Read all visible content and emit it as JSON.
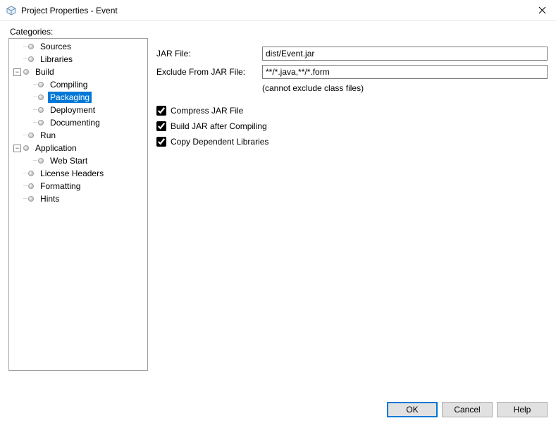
{
  "window": {
    "title": "Project Properties - Event",
    "close_glyph": "✕"
  },
  "categories_label": "Categories:",
  "tree": {
    "sources": "Sources",
    "libraries": "Libraries",
    "build": "Build",
    "build_compiling": "Compiling",
    "build_packaging": "Packaging",
    "build_deployment": "Deployment",
    "build_documenting": "Documenting",
    "run": "Run",
    "application": "Application",
    "application_webstart": "Web Start",
    "license_headers": "License Headers",
    "formatting": "Formatting",
    "hints": "Hints",
    "expander_minus": "−"
  },
  "form": {
    "jar_file_label": "JAR File:",
    "jar_file_value": "dist/Event.jar",
    "exclude_label": "Exclude From JAR File:",
    "exclude_value": "**/*.java,**/*.form",
    "exclude_hint": "(cannot exclude class files)",
    "compress_label": "Compress JAR File",
    "build_after_label": "Build JAR after Compiling",
    "copy_deps_label": "Copy Dependent Libraries"
  },
  "buttons": {
    "ok": "OK",
    "cancel": "Cancel",
    "help": "Help"
  }
}
